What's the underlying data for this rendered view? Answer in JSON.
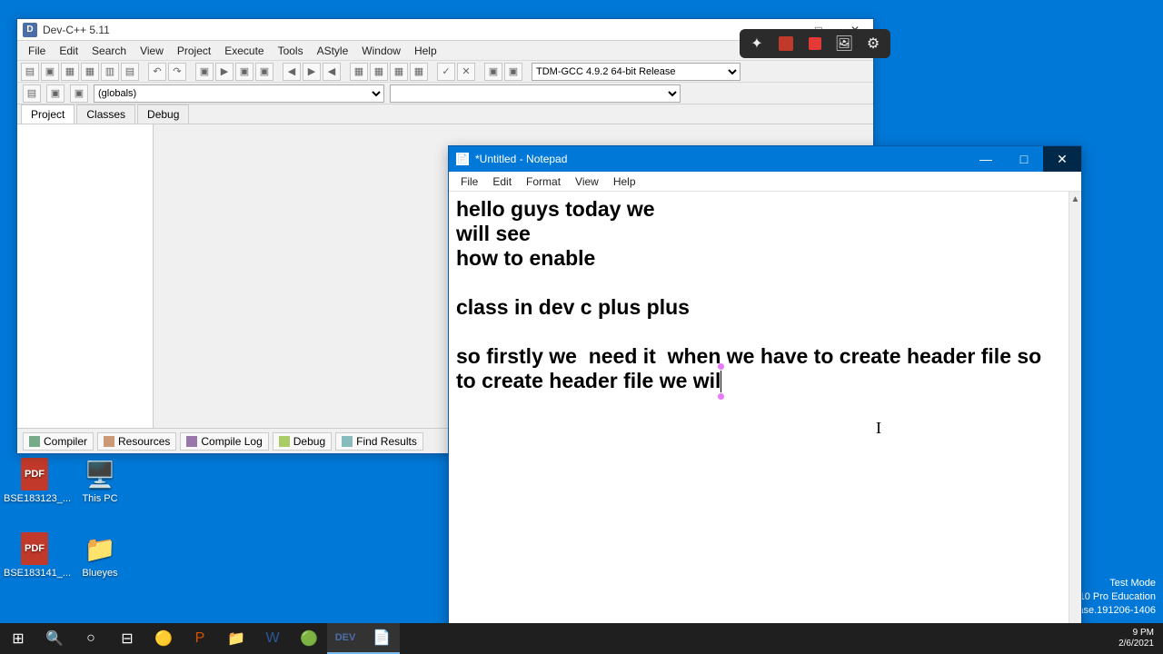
{
  "desktop": {
    "icons": [
      {
        "label": "BSE183123_...",
        "type": "pdf"
      },
      {
        "label": "This PC",
        "type": "pc"
      },
      {
        "label": "BSE183141_...",
        "type": "pdf"
      },
      {
        "label": "Blueyes",
        "type": "folder"
      }
    ]
  },
  "devcpp": {
    "title": "Dev-C++ 5.11",
    "menu": [
      "File",
      "Edit",
      "Search",
      "View",
      "Project",
      "Execute",
      "Tools",
      "AStyle",
      "Window",
      "Help"
    ],
    "compiler_combo": "TDM-GCC 4.9.2 64-bit Release",
    "globals_combo": "(globals)",
    "panel_tabs": [
      "Project",
      "Classes",
      "Debug"
    ],
    "bottom_tabs": [
      "Compiler",
      "Resources",
      "Compile Log",
      "Debug",
      "Find Results"
    ]
  },
  "notepad": {
    "title": "*Untitled - Notepad",
    "menu": [
      "File",
      "Edit",
      "Format",
      "View",
      "Help"
    ],
    "content": "hello guys today we\nwill see\nhow to enable\n\nclass in dev c plus plus\n\nso firstly we  need it  when we have to create header file so\nto create header file we wil"
  },
  "taskbar": {
    "time": "9 PM",
    "date": "2/6/2021"
  },
  "watermark": {
    "l1": "Test Mode",
    "l2": "10 Pro Education",
    "l3": "ase.191206-1406"
  }
}
